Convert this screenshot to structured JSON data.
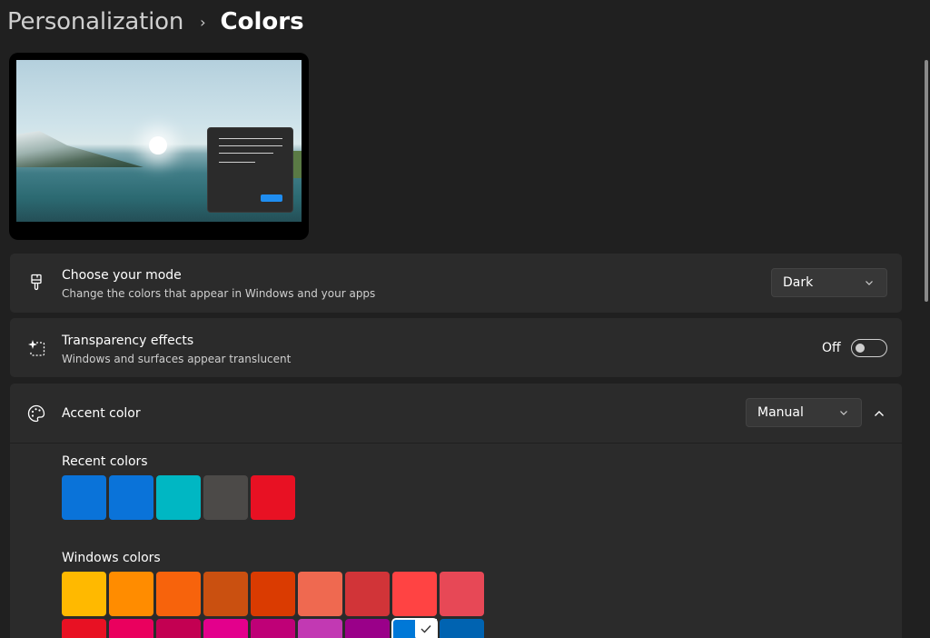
{
  "breadcrumb": {
    "parent": "Personalization",
    "separator": "›",
    "current": "Colors"
  },
  "mode": {
    "title": "Choose your mode",
    "description": "Change the colors that appear in Windows and your apps",
    "value": "Dark",
    "icon": "paintbrush-icon"
  },
  "transparency": {
    "title": "Transparency effects",
    "description": "Windows and surfaces appear translucent",
    "state": "Off",
    "icon": "transparency-sparkle-icon"
  },
  "accent": {
    "title": "Accent color",
    "value": "Manual",
    "icon": "palette-icon",
    "recent_label": "Recent colors",
    "recent_colors": [
      "#0a73d9",
      "#0a73d9",
      "#00b7c3",
      "#4c4a48",
      "#e81123"
    ],
    "windows_label": "Windows colors",
    "windows_colors_row1": [
      "#ffb900",
      "#ff8c00",
      "#f7630c",
      "#ca5010",
      "#da3b01",
      "#ef6950",
      "#d13438",
      "#ff4343",
      "#e74856"
    ],
    "windows_colors_row2": [
      "#e81123",
      "#ea005e",
      "#c30052",
      "#e3008c",
      "#bf0077",
      "#c239b3",
      "#9a0089",
      "#0078d7",
      "#0063b1"
    ],
    "selected_index_row2": 7
  }
}
